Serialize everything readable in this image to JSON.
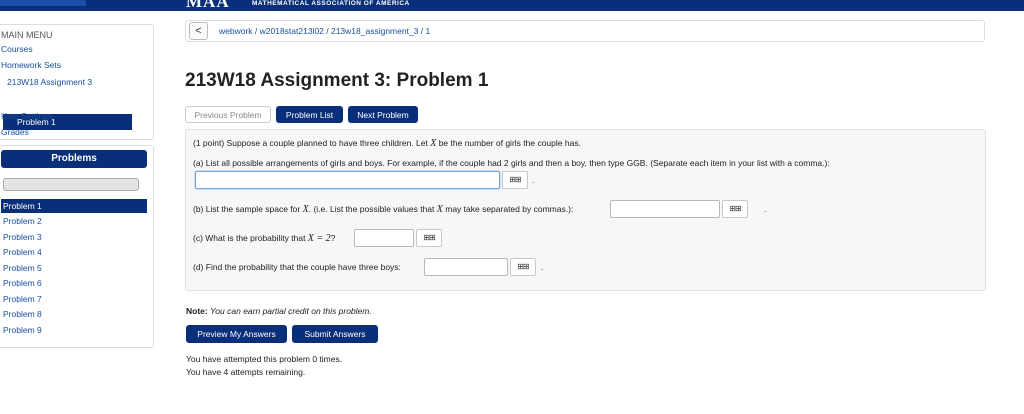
{
  "header": {
    "logo": "MAA",
    "org": "MATHEMATICAL ASSOCIATION OF AMERICA"
  },
  "main_menu": {
    "title": "MAIN MENU",
    "items": [
      "Courses",
      "Homework Sets",
      "213W18 Assignment 3",
      "Problem 1",
      "User Settings",
      "Grades"
    ]
  },
  "problems_panel": {
    "title": "Problems",
    "items": [
      "Problem 1",
      "Problem 2",
      "Problem 3",
      "Problem 4",
      "Problem 5",
      "Problem 6",
      "Problem 7",
      "Problem 8",
      "Problem 9"
    ]
  },
  "breadcrumb": {
    "back": "<",
    "path": "webwork / w2018stat213l02 / 213w18_assignment_3 / 1"
  },
  "page_title": "213W18 Assignment 3: Problem 1",
  "nav_buttons": {
    "previous": "Previous Problem",
    "list": "Problem List",
    "next": "Next Problem"
  },
  "problem": {
    "intro_before": "(1 point) Suppose a couple planned to have three children. Let ",
    "intro_var": "X",
    "intro_after": " be the number of girls the couple has.",
    "a_text": "(a) List all possible arrangements of girls and boys. For example, if the couple had 2 girls and then a boy, then type GGB. (Separate each item in your list with a comma.):",
    "b_before": "(b) List the sample space for ",
    "b_var1": "X",
    "b_mid": ". (i.e. List the possible values that ",
    "b_var2": "X",
    "b_after": " may take separated by commas.):",
    "c_before": "(c) What is the probability that ",
    "c_expr": "X = 2",
    "c_after": "?",
    "d_text": "(d) Find the probability that the couple have three boys:",
    "dot": ".",
    "mq_icon": "grid-icon",
    "mq_glyph": "⊞⊞",
    "answers": {
      "a": "",
      "b": "",
      "c": "",
      "d": ""
    }
  },
  "note": {
    "label": "Note:",
    "text": "You can earn partial credit on this problem."
  },
  "submit_buttons": {
    "preview": "Preview My Answers",
    "submit": "Submit Answers"
  },
  "attempts": {
    "line1": "You have attempted this problem 0 times.",
    "line2": "You have 4 attempts remaining."
  },
  "colors": {
    "brand": "#0a2f7a",
    "link": "#1a4fa0"
  }
}
